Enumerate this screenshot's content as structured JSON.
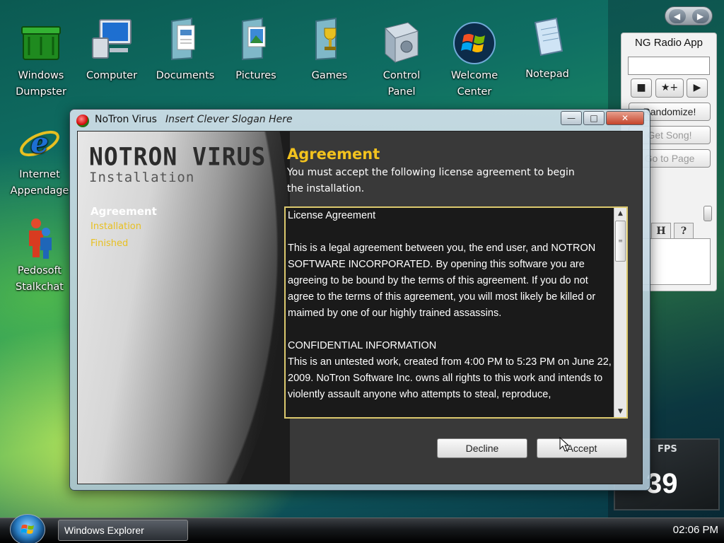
{
  "desktop": {
    "icons": [
      {
        "label": "Windows\nDumpster",
        "line1": "Windows",
        "line2": "Dumpster",
        "icon": "green-trash-bin-icon"
      },
      {
        "label": "Computer",
        "icon": "computer-icon"
      },
      {
        "label": "Documents",
        "icon": "documents-folder-icon"
      },
      {
        "label": "Pictures",
        "icon": "pictures-folder-icon"
      },
      {
        "label": "Games",
        "icon": "games-folder-icon"
      },
      {
        "label": "Control Panel",
        "line1": "Control",
        "line2": "Panel",
        "icon": "control-panel-icon"
      },
      {
        "label": "Welcome Center",
        "line1": "Welcome",
        "line2": "Center",
        "icon": "windows-logo-icon"
      },
      {
        "label": "Notepad",
        "icon": "notepad-icon"
      },
      {
        "label": "Internet Appendage",
        "line1": "Internet",
        "line2": "Appendage",
        "icon": "internet-explorer-icon"
      },
      {
        "label": "Pedosoft Stalkchat",
        "line1": "Pedosoft",
        "line2": "Stalkchat",
        "icon": "messenger-people-icon"
      }
    ]
  },
  "sidebar": {
    "nav": {
      "prev": "◀",
      "next": "▶"
    },
    "radio": {
      "title": "NG Radio App",
      "input_value": "",
      "buttons": {
        "stop": "■",
        "favorite": "★+",
        "play": "▶"
      },
      "randomize": "Randomize!",
      "get_song": "Get Song!",
      "go_to_page": "Go to Page",
      "tabs": [
        "H",
        "?"
      ]
    },
    "fps": {
      "label": "FPS",
      "value": "39"
    }
  },
  "window": {
    "title": "NoTron Virus",
    "slogan": "Insert Clever Slogan Here",
    "controls": {
      "minimize": "—",
      "maximize": "□",
      "close": "✕"
    },
    "brand": {
      "title": "NOTRON VIRUS",
      "subtitle": "Installation"
    },
    "steps": [
      "Agreement",
      "Installation",
      "Finished"
    ],
    "heading": "Agreement",
    "description": "You must accept the following license agreement to begin the installation.",
    "license": {
      "title": "License Agreement",
      "paragraph1": "This is a legal agreement between you, the end user, and NOTRON SOFTWARE INCORPORATED. By opening this software you are agreeing to be bound by the terms of this agreement. If you do not agree to the terms of this agreement, you will most likely be killed or maimed by one of our highly trained assassins.",
      "section_title": "CONFIDENTIAL INFORMATION",
      "paragraph2": "This is an untested work, created from 4:00 PM to 5:23 PM on June 22, 2009. NoTron Software Inc. owns all rights to this work and intends to violently assault anyone who attempts to steal, reproduce,"
    },
    "buttons": {
      "decline": "Decline",
      "accept": "Accept"
    }
  },
  "taskbar": {
    "task_item": "Windows Explorer",
    "clock": "02:06 PM"
  }
}
